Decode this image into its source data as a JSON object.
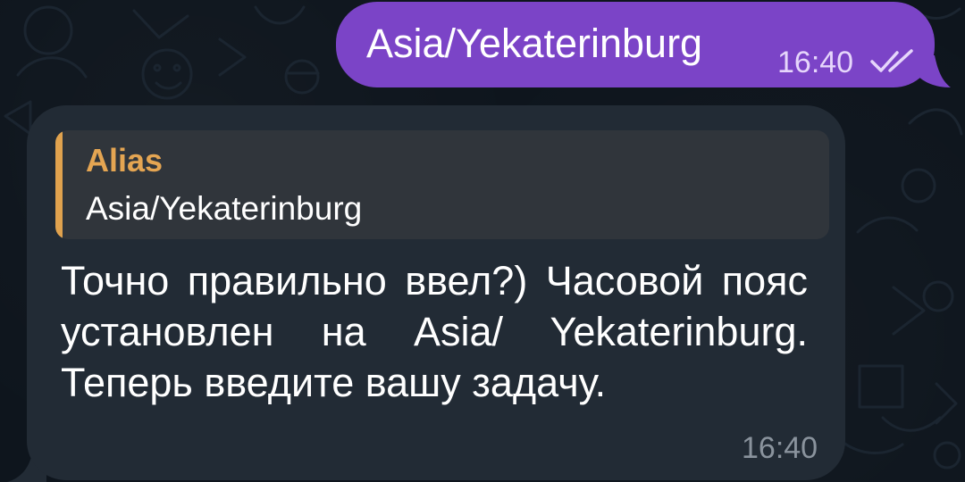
{
  "outgoing_message": {
    "text": "Asia/Yekaterinburg",
    "time": "16:40",
    "status_icon": "double-check-icon"
  },
  "incoming_message": {
    "reply": {
      "author": "Alias",
      "text": "Asia/Yekaterinburg"
    },
    "text": "Точно правильно ввел?) Часовой пояс установлен на Asia/ Yekaterinburg. Теперь введите вашу задачу.",
    "time": "16:40"
  },
  "colors": {
    "background": "#0e151d",
    "outgoing_bubble": "#7b44c7",
    "incoming_bubble": "#222b35",
    "reply_accent": "#e0a24e"
  }
}
